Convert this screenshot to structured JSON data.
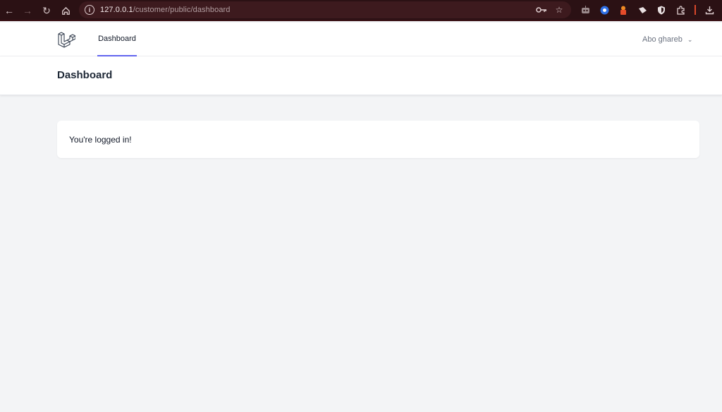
{
  "browser": {
    "url_host": "127.0.0.1",
    "url_path": "/customer/public/dashboard",
    "icons": [
      "back-icon",
      "forward-icon",
      "reload-icon",
      "home-icon",
      "site-info-icon",
      "password-key-icon",
      "bookmark-star-icon",
      "extension-icons",
      "downloads-icon"
    ]
  },
  "nav": {
    "links": [
      {
        "label": "Dashboard",
        "active": true
      }
    ],
    "user_name": "Abo ghareb",
    "accent_color": "#6366f1"
  },
  "header": {
    "title": "Dashboard"
  },
  "main": {
    "message": "You're logged in!"
  }
}
